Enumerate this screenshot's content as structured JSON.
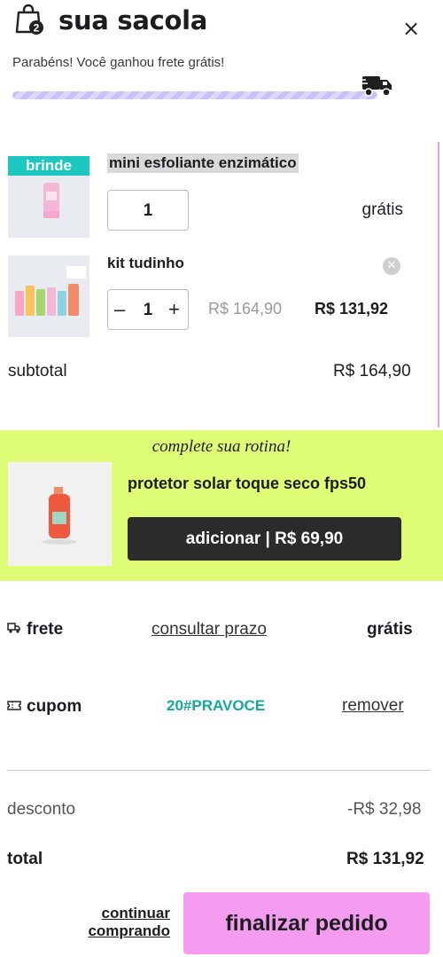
{
  "header": {
    "title": "sua sacola",
    "cart_count": "2",
    "close_label": "×",
    "shipping_message": "Parabéns! Você ganhou frete grátis!",
    "shipping_progress_percent": 100
  },
  "items": [
    {
      "badge": "brinde",
      "name": "mini esfoliante enzimático",
      "quantity": "1",
      "price": "grátis"
    },
    {
      "name": "kit tudinho",
      "quantity": "1",
      "minus_label": "–",
      "plus_label": "+",
      "old_price": "R$ 164,90",
      "new_price": "R$ 131,92",
      "remove_label": "✕"
    }
  ],
  "subtotal": {
    "label": "subtotal",
    "value": "R$ 164,90"
  },
  "upsell": {
    "heading": "complete sua rotina!",
    "product_name": "protetor solar toque seco fps50",
    "button_label": "adicionar | R$ 69,90"
  },
  "shipping": {
    "label": "frete",
    "link": "consultar prazo",
    "value": "grátis"
  },
  "coupon": {
    "label": "cupom",
    "code": "20#PRAVOCE",
    "remove_link": "remover"
  },
  "summary": {
    "discount_label": "desconto",
    "discount_value": "-R$ 32,98",
    "total_label": "total",
    "total_value": "R$ 131,92"
  },
  "footer": {
    "continue_line1": "continuar",
    "continue_line2": "comprando",
    "checkout_label": "finalizar pedido"
  },
  "colors": {
    "progress": "#c8c0f7",
    "badge": "#1cc7c1",
    "upsell_bg": "#dffc77",
    "coupon_code": "#16a7a2",
    "checkout_bg": "#f39cf0"
  }
}
